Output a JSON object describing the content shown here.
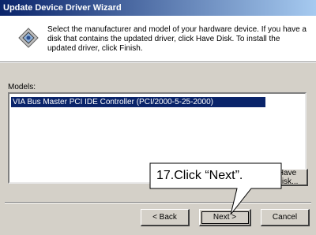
{
  "window": {
    "title": "Update Device Driver Wizard"
  },
  "header": {
    "icon": "hardware-wizard-icon",
    "instructions": "Select the manufacturer and model of your hardware device. If you have a disk that contains the updated driver, click Have Disk. To install the updated driver, click Finish."
  },
  "models": {
    "label": "Models:",
    "items": [
      "VIA Bus Master PCI IDE Controller (PCI/2000-5-25-2000)"
    ],
    "selected_index": 0
  },
  "buttons": {
    "have_disk": "Have Disk...",
    "back": "< Back",
    "next": "Next >",
    "cancel": "Cancel"
  },
  "annotation": {
    "text": "17.Click “Next”."
  }
}
